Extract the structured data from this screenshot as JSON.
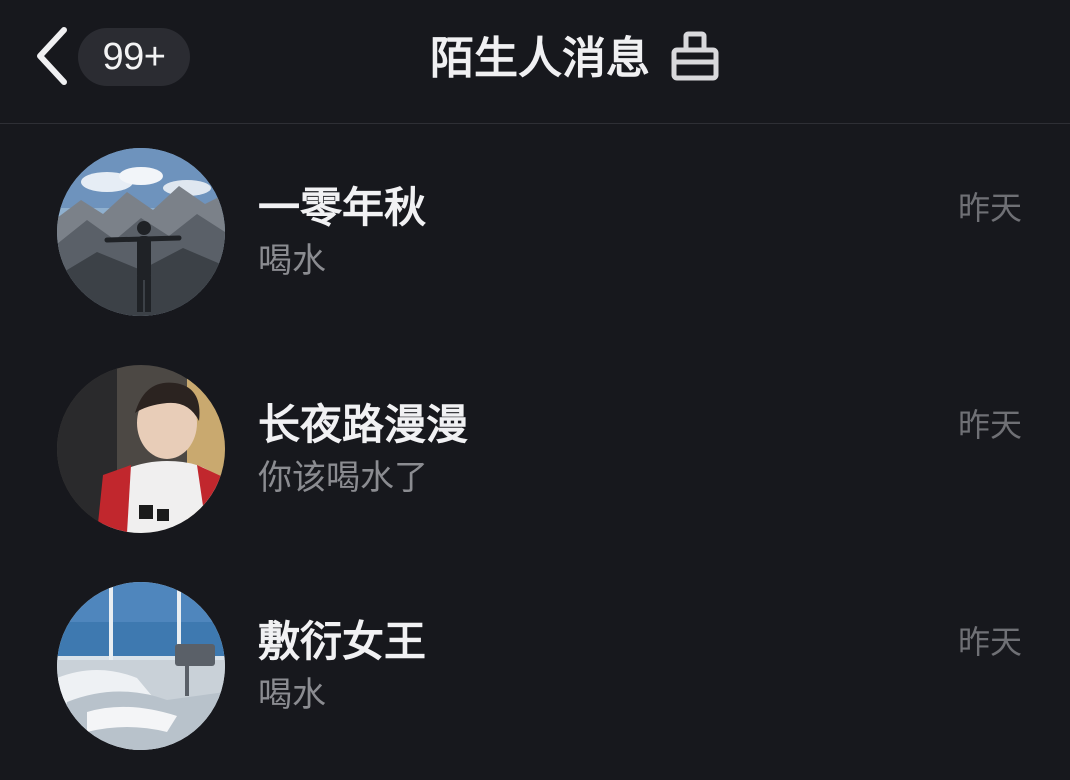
{
  "header": {
    "back_icon": "chevron-left-icon",
    "unread_badge": "99+",
    "title": "陌生人消息",
    "clean_icon": "broom-clean-icon"
  },
  "colors": {
    "background": "#17181d",
    "badge_background": "#2b2c32",
    "name_text": "#f1f1f3",
    "preview_text": "#8b8c91",
    "time_text": "#6f7075",
    "divider": "#2e2f35"
  },
  "conversations": [
    {
      "name": "一零年秋",
      "preview": "喝水",
      "time": "昨天",
      "avatar": "mountain-photo-avatar"
    },
    {
      "name": "长夜路漫漫",
      "preview": "你该喝水了",
      "time": "昨天",
      "avatar": "boy-selfie-avatar"
    },
    {
      "name": "敷衍女王",
      "preview": "喝水",
      "time": "昨天",
      "avatar": "seaview-room-avatar"
    }
  ]
}
